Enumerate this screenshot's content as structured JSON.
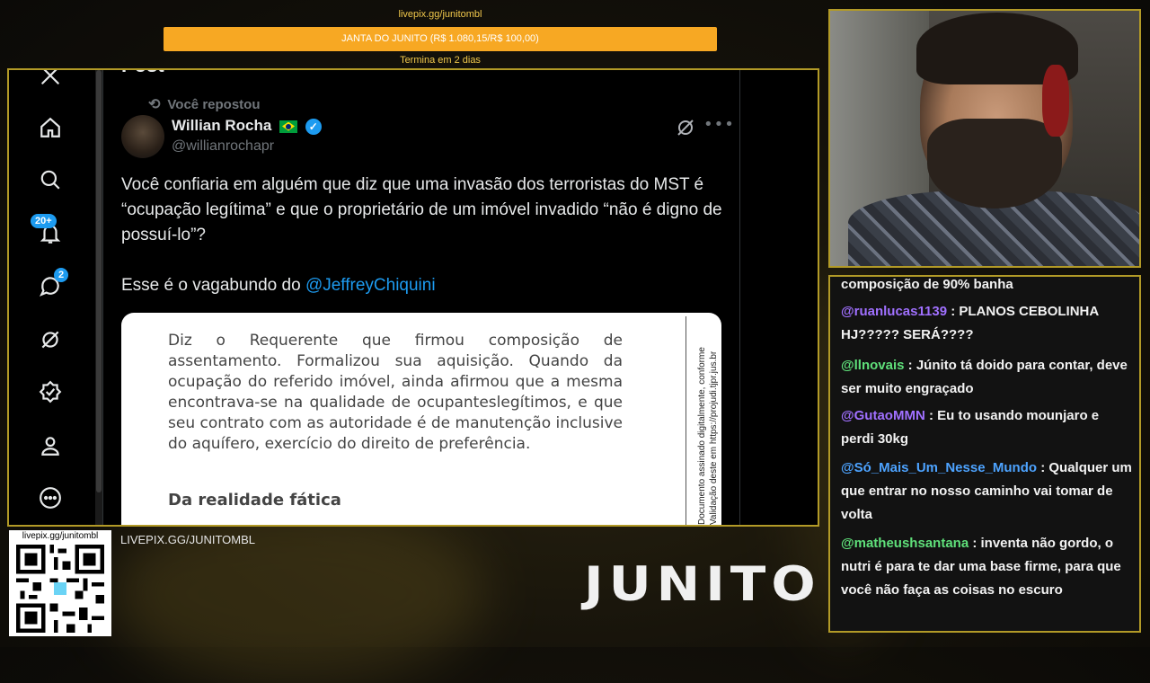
{
  "donation": {
    "url": "livepix.gg/junitombl",
    "goal_text": "JANTA DO JUNITO (R$ 1.080,15/R$ 100,00)",
    "progress_fraction": 1.0,
    "ends": "Termina em 2 dias"
  },
  "x_sidebar": {
    "items": [
      {
        "name": "x-logo-icon"
      },
      {
        "name": "home-icon"
      },
      {
        "name": "search-icon"
      },
      {
        "name": "notifications-icon",
        "badge": "20+"
      },
      {
        "name": "messages-icon",
        "badge": "2"
      },
      {
        "name": "grok-icon"
      },
      {
        "name": "verified-icon"
      },
      {
        "name": "profile-icon"
      },
      {
        "name": "more-icon"
      }
    ]
  },
  "tweet": {
    "page_title": "Post",
    "repost_label": "Você repostou",
    "author_name": "Willian Rocha",
    "author_handle": "@willianrochapr",
    "text_p1": "Você confiaria em alguém que diz que uma invasão dos terroristas do MST é “ocupação legítima” e que o proprietário de um imóvel invadido “não é digno de possuí-lo”?",
    "text_p2_prefix": "Esse é o vagabundo do ",
    "text_p2_mention": "@JeffreyChiquini",
    "image": {
      "body": "Diz o Requerente que firmou composição de assentamento. Formalizou sua aquisição. Quando da ocupação do referido imóvel, ainda afirmou que a mesma encontrava-se na qualidade de ocupanteslegítimos, e que seu contrato com as autoridade é de manutenção inclusive do aquífero, exercício do direito de preferência.",
      "heading": "Da realidade fática",
      "side_line1": "Documento assinado digitalmente, conforme",
      "side_line2": "Validação deste em https://projudi.tjpr.jus.br"
    }
  },
  "chat": {
    "messages": [
      {
        "user": "",
        "text": "composição de 90% banha",
        "color": "#f2f2f2"
      },
      {
        "user": "@ruanlucas1139",
        "text": " : PLANOS CEBOLINHA HJ????? SERÁ????",
        "color": "#a070ff"
      },
      {
        "user": "@llnovais",
        "text": " : Júnito tá doido para contar, deve ser muito engraçado",
        "color": "#5fe07a"
      },
      {
        "user": "@GutaoMMN",
        "text": " : Eu to usando mounjaro e perdi 30kg",
        "color": "#a070ff"
      },
      {
        "user": "@Só_Mais_Um_Nesse_Mundo",
        "text": " : Qualquer um que entrar no nosso caminho vai tomar de volta",
        "color": "#4da3ff"
      },
      {
        "user": "@matheushsantana",
        "text": " : inventa não gordo, o nutri é para te dar uma base firme, para que você não faça as coisas no escuro",
        "color": "#5fe07a"
      }
    ]
  },
  "footer": {
    "qr_label": "livepix.gg/junitombl",
    "livepix_url": "LIVEPIX.GG/JUNITOMBL",
    "logo": "JUNITO"
  },
  "colors": {
    "frame_border": "#b29a27",
    "donation_bar": "#f7a823",
    "x_blue": "#1d9bf0"
  }
}
